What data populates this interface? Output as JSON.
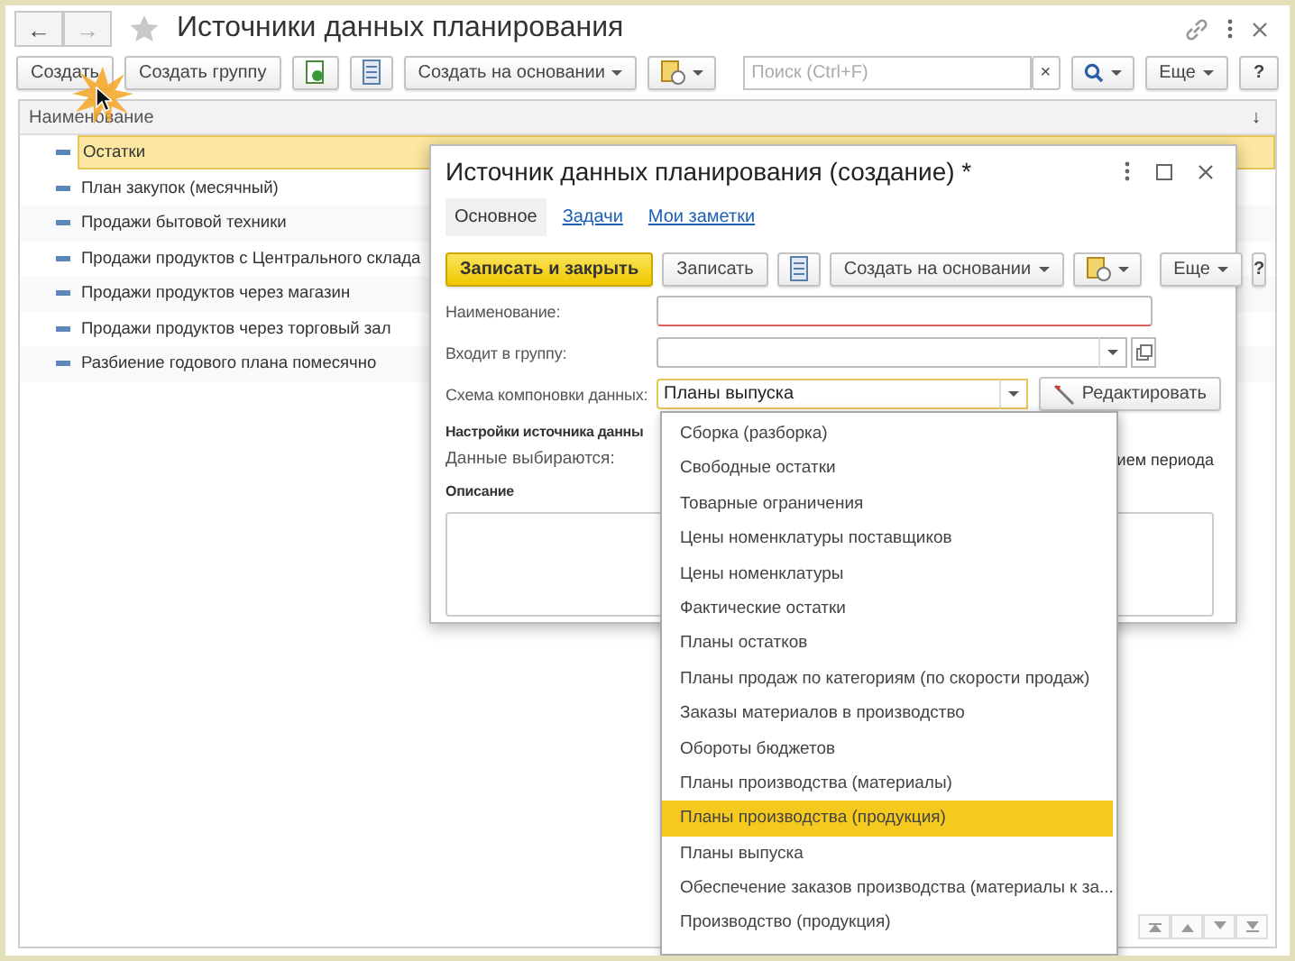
{
  "window": {
    "title": "Источники данных планирования",
    "back": "←",
    "forward": "→"
  },
  "toolbar": {
    "buttons": [
      {
        "kind": "text",
        "label": "Создать"
      },
      {
        "kind": "text",
        "label": "Создать группу"
      },
      {
        "kind": "copy"
      },
      {
        "kind": "list"
      },
      {
        "kind": "menu",
        "label": "Создать на основании"
      },
      {
        "kind": "report"
      }
    ],
    "search": {
      "placeholder": "Поиск (Ctrl+F)",
      "clear": "×"
    },
    "more": "Еще",
    "help": "?"
  },
  "table": {
    "columns": [
      {
        "label": "Наименование",
        "sort": "↓"
      }
    ],
    "rows": [
      {
        "name": "Остатки",
        "selected": true
      },
      {
        "name": "План закупок (месячный)",
        "selected": false
      },
      {
        "name": "Продажи бытовой техники",
        "selected": false
      },
      {
        "name": "Продажи продуктов с Центрального склада",
        "selected": false
      },
      {
        "name": "Продажи продуктов через магазин",
        "selected": false
      },
      {
        "name": "Продажи продуктов через торговый зал",
        "selected": false
      },
      {
        "name": "Разбиение годового плана помесячно",
        "selected": false
      }
    ]
  },
  "dialog": {
    "title": "Источник данных планирования (создание) *",
    "tabs": [
      {
        "label": "Основное",
        "selected": true
      },
      {
        "label": "Задачи",
        "selected": false
      },
      {
        "label": "Мои заметки",
        "selected": false
      }
    ],
    "toolbar": {
      "buttons": [
        {
          "kind": "primary",
          "label": "Записать и закрыть"
        },
        {
          "kind": "text",
          "label": "Записать"
        },
        {
          "kind": "list"
        },
        {
          "kind": "menu",
          "label": "Создать на основании"
        },
        {
          "kind": "report"
        }
      ],
      "more": "Еще",
      "help": "?"
    },
    "fields": [
      {
        "kind": "required",
        "label": "Наименование:"
      },
      {
        "kind": "group",
        "label": "Входит в группу:"
      },
      {
        "kind": "schema",
        "label": "Схема компоновки данных:",
        "value": "Планы выпуска",
        "edit": "Редактировать"
      }
    ],
    "section": "Настройки источника данны",
    "data_label": "Данные выбираются:",
    "data_tail": "ием периода",
    "description": "Описание"
  },
  "dropdown": {
    "items": [
      {
        "label": "Сборка (разборка)",
        "selected": false
      },
      {
        "label": "Свободные остатки",
        "selected": false
      },
      {
        "label": "Товарные ограничения",
        "selected": false
      },
      {
        "label": "Цены номенклатуры поставщиков",
        "selected": false
      },
      {
        "label": "Цены номенклатуры",
        "selected": false
      },
      {
        "label": "Фактические остатки",
        "selected": false
      },
      {
        "label": "Планы остатков",
        "selected": false
      },
      {
        "label": "Планы продаж по категориям (по скорости продаж)",
        "selected": false
      },
      {
        "label": "Заказы материалов в производство",
        "selected": false
      },
      {
        "label": "Обороты бюджетов",
        "selected": false
      },
      {
        "label": "Планы производства (материалы)",
        "selected": false
      },
      {
        "label": "Планы производства (продукция)",
        "selected": true
      },
      {
        "label": "Планы выпуска",
        "selected": false
      },
      {
        "label": "Обеспечение заказов производства (материалы к за...",
        "selected": false
      },
      {
        "label": "Производство (продукция)",
        "selected": false
      }
    ]
  }
}
